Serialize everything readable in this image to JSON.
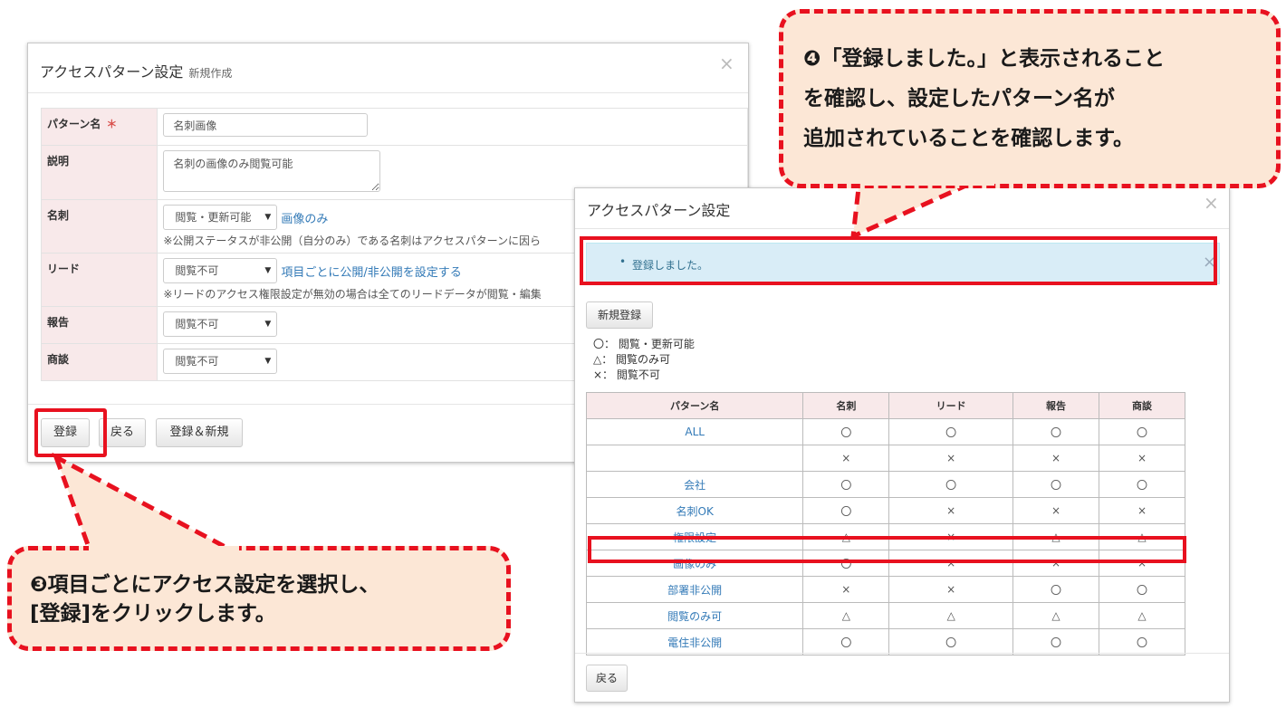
{
  "left_dialog": {
    "title": "アクセスパターン設定",
    "subtitle": "新規作成",
    "close": "×",
    "fields": {
      "pattern_name": {
        "label": "パターン名",
        "required_mark": "＊",
        "value": "名刺画像"
      },
      "description": {
        "label": "説明",
        "value": "名刺の画像のみ閲覧可能"
      },
      "meishi": {
        "label": "名刺",
        "select": "閲覧・更新可能",
        "link": "画像のみ",
        "note": "※公開ステータスが非公開（自分のみ）である名刺はアクセスパターンに因ら"
      },
      "lead": {
        "label": "リード",
        "select": "閲覧不可",
        "link": "項目ごとに公開/非公開を設定する",
        "note": "※リードのアクセス権限設定が無効の場合は全てのリードデータが閲覧・編集"
      },
      "report": {
        "label": "報告",
        "select": "閲覧不可"
      },
      "deal": {
        "label": "商談",
        "select": "閲覧不可"
      }
    },
    "buttons": {
      "register": "登録",
      "back": "戻る",
      "register_new": "登録＆新規"
    }
  },
  "right_dialog": {
    "title": "アクセスパターン設定",
    "close": "×",
    "alert_text": "登録しました。",
    "alert_close": "×",
    "new_button": "新規登録",
    "legend": [
      "〇： 閲覧・更新可能",
      "△： 閲覧のみ可",
      "×： 閲覧不可"
    ],
    "table": {
      "headers": [
        "パターン名",
        "名刺",
        "リード",
        "報告",
        "商談"
      ],
      "rows": [
        [
          "ALL",
          "〇",
          "〇",
          "〇",
          "〇"
        ],
        [
          "",
          "×",
          "×",
          "×",
          "×"
        ],
        [
          "会社",
          "〇",
          "〇",
          "〇",
          "〇"
        ],
        [
          "名刺OK",
          "〇",
          "×",
          "×",
          "×"
        ],
        [
          "権限設定",
          "△",
          "×",
          "△",
          "△"
        ],
        [
          "画像のみ",
          "〇",
          "×",
          "×",
          "×"
        ],
        [
          "部署非公開",
          "×",
          "×",
          "〇",
          "〇"
        ],
        [
          "閲覧のみ可",
          "△",
          "△",
          "△",
          "△"
        ],
        [
          "電住非公開",
          "〇",
          "〇",
          "〇",
          "〇"
        ]
      ]
    },
    "back_button": "戻る"
  },
  "callouts": {
    "step3": {
      "line1": "❸項目ごとにアクセス設定を選択し、",
      "line2": "[登録]をクリックします。"
    },
    "step4": {
      "line1": "❹「登録しました。」と表示されること",
      "line2": "を確認し、設定したパターン名が",
      "line3": "追加されていることを確認します。"
    }
  },
  "colors": {
    "accent_red": "#e8111f",
    "callout_fill": "#fce7d6",
    "link_blue": "#337ab7",
    "label_pink": "#f8e9ea",
    "alert_blue": "#d9edf7"
  }
}
